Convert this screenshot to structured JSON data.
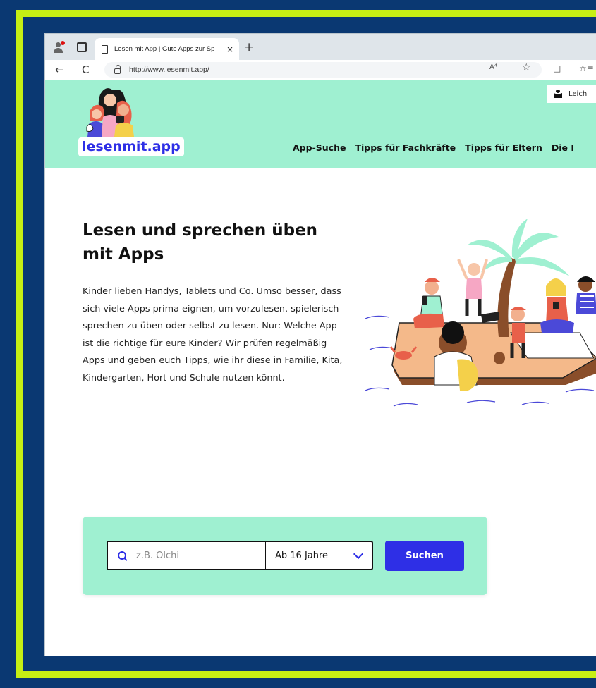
{
  "browser": {
    "tab_title": "Lesen mit App | Gute Apps zur Sp",
    "tab_close": "×",
    "new_tab": "+",
    "url": "http://www.lesenmit.app/",
    "back": "←",
    "reload": "C",
    "read_aloud": "A⁴",
    "favorite": "☆",
    "split_screen": "◫",
    "favorites": "☆≡"
  },
  "site": {
    "logo_text": "lesenmit.app",
    "easy_language": "Leich",
    "nav": [
      "App-Suche",
      "Tipps für Fachkräfte",
      "Tipps für Eltern",
      "Die I"
    ]
  },
  "hero": {
    "title": "Lesen und sprechen üben mit Apps",
    "text": "Kinder lieben Handys, Tablets und Co. Umso besser, dass sich viele Apps prima eignen, um vorzulesen, spielerisch sprechen zu üben oder selbst zu lesen. Nur: Welche App ist die richtige für eure Kinder? Wir prüfen regelmäßig Apps und geben euch Tipps, wie ihr diese in Familie, Kita, Kindergarten, Hort und Schule nutzen könnt."
  },
  "search": {
    "placeholder": "z.B. Olchi",
    "value": "",
    "age_selected": "Ab 16 Jahre",
    "button": "Suchen"
  },
  "colors": {
    "mint": "#9ff0d1",
    "brand_blue": "#2e2fe6",
    "frame_navy": "#0a3872",
    "frame_lime": "#c6ef14"
  }
}
